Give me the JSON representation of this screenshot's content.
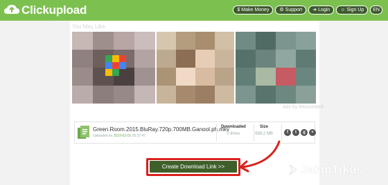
{
  "header": {
    "logo_text": "Clickupload",
    "nav": [
      {
        "label": "Make Money",
        "icon": "money-icon"
      },
      {
        "label": "Support",
        "icon": "support-icon"
      },
      {
        "label": "Login",
        "icon": "login-icon"
      },
      {
        "label": "Sign Up",
        "icon": "signup-icon"
      }
    ],
    "flag_label": "EN"
  },
  "recommend": {
    "heading": "You May Like",
    "caption": "Ads by Revcontent"
  },
  "file": {
    "name": "Green.Room.2015.BluRay.720p.700MB.Ganool.ph.mkv",
    "uploaded_prefix": "Uploaded on ",
    "uploaded_date": "2019-02-01",
    "uploaded_time": " 05:37:47",
    "downloaded_label": "Downloaded",
    "downloaded_value": "0 times",
    "size_label": "Size",
    "size_value": "699.2 MB",
    "share_icons": [
      "f",
      "t",
      "g",
      "+"
    ]
  },
  "download_button": {
    "label": "Create Download Link >>"
  },
  "watermark": {
    "text": "JalanTikus"
  },
  "colors": {
    "header_green": "#7cc04f",
    "button_green": "#3f5f2a",
    "highlight_red": "#d9201c"
  }
}
